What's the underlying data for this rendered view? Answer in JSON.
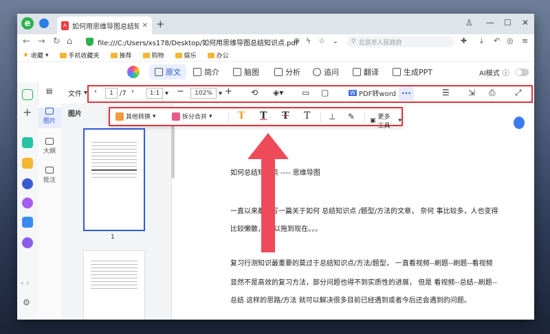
{
  "browser": {
    "tab_title": "如何用思维导图总结知识点.pdf",
    "url": "file:///C:/Users/xs178/Desktop/如何用思维导图总结知识点.pdf",
    "search_placeholder": "北京市人民政府",
    "bookmarks": [
      "收藏",
      "手机收藏夹",
      "推荐",
      "购物",
      "娱乐",
      "办公"
    ]
  },
  "app_menu": {
    "items": [
      "原文",
      "简介",
      "脑图",
      "分析",
      "追问",
      "翻译",
      "生成PPT"
    ],
    "active": "原文",
    "ai_mode_label": "AI模式"
  },
  "toolbar": {
    "file_label": "文件",
    "page_current": "1",
    "page_total": "/7",
    "fit_label": "1:1",
    "zoom": "102%",
    "pdf_to_word": "PDF转word",
    "more": "···"
  },
  "sub_toolbar": {
    "other_convert": "其他转换",
    "split_merge": "拆分合并",
    "more_tools": "更多工具"
  },
  "side_panel": {
    "items": [
      "图片",
      "大纲",
      "批注"
    ],
    "active": "图片"
  },
  "thumbnails": {
    "title": "图片",
    "page1_num": "1"
  },
  "document": {
    "lines": [
      "如何总结知识点 ----  思维导图",
      "一直以来都想写一篇关于如何  总结知识点  /题型/方法的文章，  奈何  事比较多，人也变得",
      "比较懒散，  所以拖到现在。。。",
      "复习行测知识最重要的莫过于总结知识点/方法/题型，  一直看视频--刷题--刷题--看视频",
      "显然不是高效的复习方法，部分问题也得不到实质性的进展，  但是  看视频--总结--刷题--",
      "总结  这样的思路/方法  就可以解决很多目前已经遇到或者今后还会遇到的问题。"
    ]
  },
  "colors": {
    "highlight_red": "#e0323c",
    "accent_blue": "#2d5bd8",
    "arrow": "#ef4a5a"
  }
}
